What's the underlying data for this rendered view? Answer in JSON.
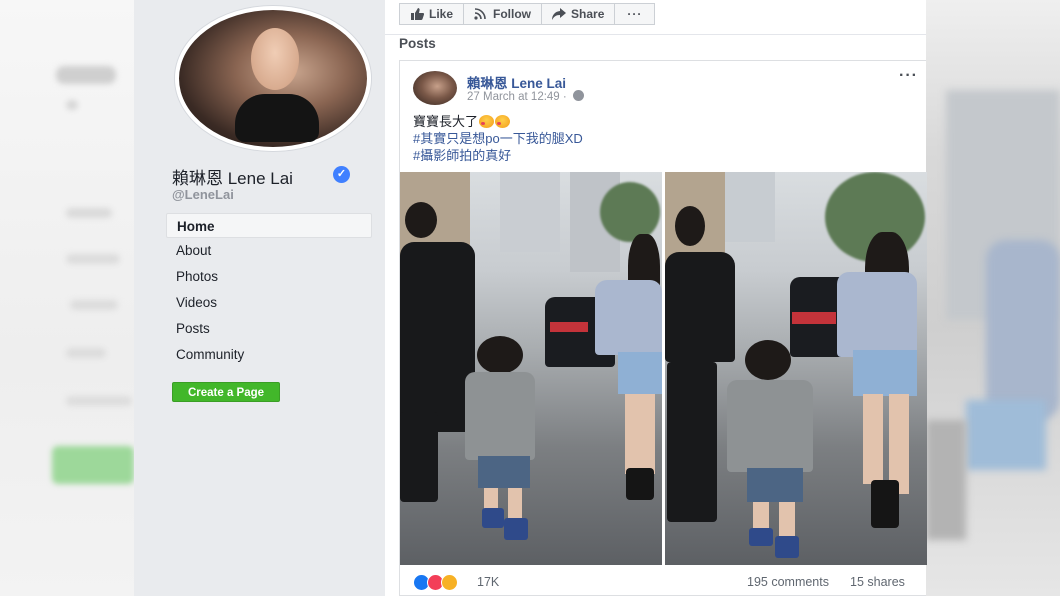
{
  "page": {
    "name": "賴琳恩 Lene Lai",
    "handle": "@LeneLai"
  },
  "nav": [
    "Home",
    "About",
    "Photos",
    "Videos",
    "Posts",
    "Community"
  ],
  "create_page_label": "Create a Page",
  "actions": {
    "like": "Like",
    "follow": "Follow",
    "share": "Share",
    "more": "···"
  },
  "posts_title": "Posts",
  "post": {
    "author": "賴琳恩 Lene Lai",
    "time": "27 March at 12:49 ·",
    "more": "···",
    "text": "寶寶長大了",
    "hashtags": [
      "#其實只是想po一下我的腿XD",
      "#攝影師拍的真好"
    ],
    "reactions": {
      "icons": [
        "like-icon",
        "love-icon",
        "haha-icon"
      ],
      "count": "17K"
    },
    "comments": "195 comments",
    "shares": "15 shares"
  },
  "colors": {
    "link": "#385898",
    "sidebar_bg": "#e9ebee",
    "create_button": "#42b72a",
    "verified": "#4080ff"
  }
}
